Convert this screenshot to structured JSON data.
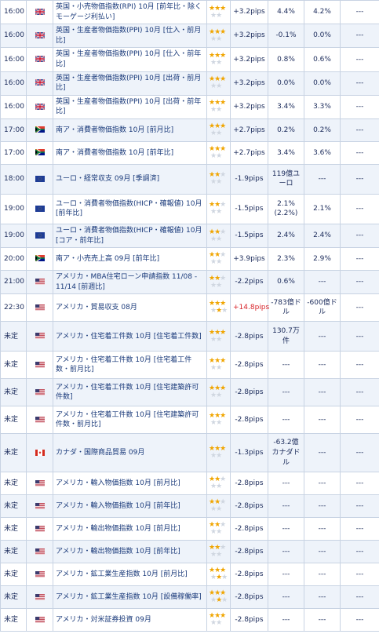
{
  "rows": [
    {
      "time": "16:00",
      "flag": "uk",
      "name": "英国・小売物価指数(RPI) 10月 [前年比・除くモーゲージ利払い]",
      "stars": 3,
      "pips": "+3.2pips",
      "up": false,
      "v1": "4.4%",
      "v2": "4.2%",
      "v3": "---"
    },
    {
      "time": "16:00",
      "flag": "uk",
      "name": "英国・生産者物価指数(PPI) 10月 [仕入・前月比]",
      "stars": 3,
      "pips": "+3.2pips",
      "up": false,
      "v1": "-0.1%",
      "v2": "0.0%",
      "v3": "---"
    },
    {
      "time": "16:00",
      "flag": "uk",
      "name": "英国・生産者物価指数(PPI) 10月 [仕入・前年比]",
      "stars": 3,
      "pips": "+3.2pips",
      "up": false,
      "v1": "0.8%",
      "v2": "0.6%",
      "v3": "---"
    },
    {
      "time": "16:00",
      "flag": "uk",
      "name": "英国・生産者物価指数(PPI) 10月 [出荷・前月比]",
      "stars": 3,
      "pips": "+3.2pips",
      "up": false,
      "v1": "0.0%",
      "v2": "0.0%",
      "v3": "---"
    },
    {
      "time": "16:00",
      "flag": "uk",
      "name": "英国・生産者物価指数(PPI) 10月 [出荷・前年比]",
      "stars": 3,
      "pips": "+3.2pips",
      "up": false,
      "v1": "3.4%",
      "v2": "3.3%",
      "v3": "---"
    },
    {
      "time": "17:00",
      "flag": "za",
      "name": "南ア・消費者物価指数 10月 [前月比]",
      "stars": 3,
      "pips": "+2.7pips",
      "up": false,
      "v1": "0.2%",
      "v2": "0.2%",
      "v3": "---"
    },
    {
      "time": "17:00",
      "flag": "za",
      "name": "南ア・消費者物価指数 10月 [前年比]",
      "stars": 3,
      "pips": "+2.7pips",
      "up": false,
      "v1": "3.4%",
      "v2": "3.6%",
      "v3": "---"
    },
    {
      "time": "18:00",
      "flag": "eu",
      "name": "ユーロ・経常収支 09月 [季調済]",
      "stars": 2,
      "pips": "-1.9pips",
      "up": false,
      "v1": "119億ユーロ",
      "v2": "---",
      "v3": "---"
    },
    {
      "time": "19:00",
      "flag": "eu",
      "name": "ユーロ・消費者物価指数(HICP・確報値) 10月 [前年比]",
      "stars": 2,
      "pips": "-1.5pips",
      "up": false,
      "v1": "2.1% (2.2%)",
      "v2": "2.1%",
      "v3": "---"
    },
    {
      "time": "19:00",
      "flag": "eu",
      "name": "ユーロ・消費者物価指数(HICP・確報値) 10月 [コア・前年比]",
      "stars": 2,
      "pips": "-1.5pips",
      "up": false,
      "v1": "2.4%",
      "v2": "2.4%",
      "v3": "---"
    },
    {
      "time": "20:00",
      "flag": "za",
      "name": "南ア・小売売上高 09月 [前年比]",
      "stars": 2,
      "pips": "+3.9pips",
      "up": false,
      "v1": "2.3%",
      "v2": "2.9%",
      "v3": "---"
    },
    {
      "time": "21:00",
      "flag": "us",
      "name": "アメリカ・MBA住宅ローン申請指数 11/08 - 11/14 [前週比]",
      "stars": 2,
      "pips": "-2.2pips",
      "up": false,
      "v1": "0.6%",
      "v2": "---",
      "v3": "---"
    },
    {
      "time": "22:30",
      "flag": "us",
      "name": "アメリカ・貿易収支 08月",
      "stars": 4,
      "pips": "+14.8pips",
      "up": true,
      "v1": "-783億ドル",
      "v2": "-600億ドル",
      "v3": "---"
    },
    {
      "time": "未定",
      "flag": "us",
      "name": "アメリカ・住宅着工件数 10月 [住宅着工件数]",
      "stars": 3,
      "pips": "-2.8pips",
      "up": false,
      "v1": "130.7万件",
      "v2": "---",
      "v3": "---"
    },
    {
      "time": "未定",
      "flag": "us",
      "name": "アメリカ・住宅着工件数 10月 [住宅着工件数・前月比]",
      "stars": 3,
      "pips": "-2.8pips",
      "up": false,
      "v1": "---",
      "v2": "---",
      "v3": "---"
    },
    {
      "time": "未定",
      "flag": "us",
      "name": "アメリカ・住宅着工件数 10月 [住宅建築許可件数]",
      "stars": 3,
      "pips": "-2.8pips",
      "up": false,
      "v1": "---",
      "v2": "---",
      "v3": "---"
    },
    {
      "time": "未定",
      "flag": "us",
      "name": "アメリカ・住宅着工件数 10月 [住宅建築許可件数・前月比]",
      "stars": 3,
      "pips": "-2.8pips",
      "up": false,
      "v1": "---",
      "v2": "---",
      "v3": "---"
    },
    {
      "time": "未定",
      "flag": "ca",
      "name": "カナダ・国際商品貿易 09月",
      "stars": 3,
      "pips": "-1.3pips",
      "up": false,
      "v1": "-63.2億カナダドル",
      "v2": "---",
      "v3": "---"
    },
    {
      "time": "未定",
      "flag": "us",
      "name": "アメリカ・輸入物価指数 10月 [前月比]",
      "stars": 2,
      "pips": "-2.8pips",
      "up": false,
      "v1": "---",
      "v2": "---",
      "v3": "---"
    },
    {
      "time": "未定",
      "flag": "us",
      "name": "アメリカ・輸入物価指数 10月 [前年比]",
      "stars": 2,
      "pips": "-2.8pips",
      "up": false,
      "v1": "---",
      "v2": "---",
      "v3": "---"
    },
    {
      "time": "未定",
      "flag": "us",
      "name": "アメリカ・輸出物価指数 10月 [前月比]",
      "stars": 2,
      "pips": "-2.8pips",
      "up": false,
      "v1": "---",
      "v2": "---",
      "v3": "---"
    },
    {
      "time": "未定",
      "flag": "us",
      "name": "アメリカ・輸出物価指数 10月 [前年比]",
      "stars": 2,
      "pips": "-2.8pips",
      "up": false,
      "v1": "---",
      "v2": "---",
      "v3": "---"
    },
    {
      "time": "未定",
      "flag": "us",
      "name": "アメリカ・鉱工業生産指数 10月 [前月比]",
      "stars": 4,
      "pips": "-2.8pips",
      "up": false,
      "v1": "---",
      "v2": "---",
      "v3": "---"
    },
    {
      "time": "未定",
      "flag": "us",
      "name": "アメリカ・鉱工業生産指数 10月 [設備稼働率]",
      "stars": 4,
      "pips": "-2.8pips",
      "up": false,
      "v1": "---",
      "v2": "---",
      "v3": "---"
    },
    {
      "time": "未定",
      "flag": "us",
      "name": "アメリカ・対米証券投資 09月",
      "stars": 3,
      "pips": "-2.8pips",
      "up": false,
      "v1": "---",
      "v2": "---",
      "v3": "---"
    }
  ],
  "colors": {
    "up": "#d8252b",
    "star_on": "#f0a500",
    "star_off": "#cfd6e0"
  },
  "row_heights": []
}
